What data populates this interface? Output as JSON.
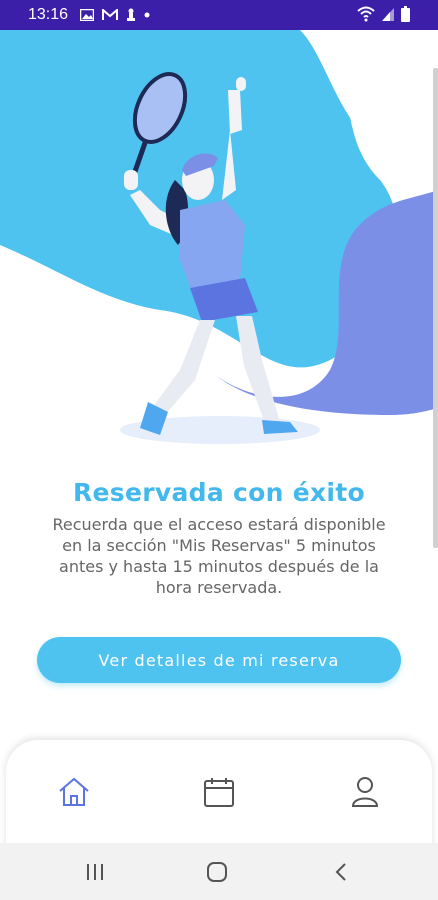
{
  "status_bar": {
    "time": "13:16",
    "icons": [
      "gallery-icon",
      "gmail-icon",
      "chess-icon",
      "dot-icon",
      "wifi-icon",
      "signal-icon",
      "battery-icon"
    ]
  },
  "main": {
    "title": "Reservada con éxito",
    "message": "Recuerda que el acceso estará disponible en la sección \"Mis Reservas\" 5  minutos antes y hasta 15 minutos después de la hora reservada.",
    "cta_label": "Ver detalles de mi reserva"
  },
  "bottom_nav": {
    "items": [
      "home-icon",
      "calendar-icon",
      "profile-icon"
    ],
    "active": "home-icon"
  },
  "system_nav": [
    "recent-apps-icon",
    "home-circle-icon",
    "back-icon"
  ],
  "colors": {
    "status_bar": "#3b1fa8",
    "accent": "#42b8ec",
    "button": "#4fc3f0",
    "blob_blue": "#4fc3f0",
    "blob_purple": "#7b8fe6"
  }
}
